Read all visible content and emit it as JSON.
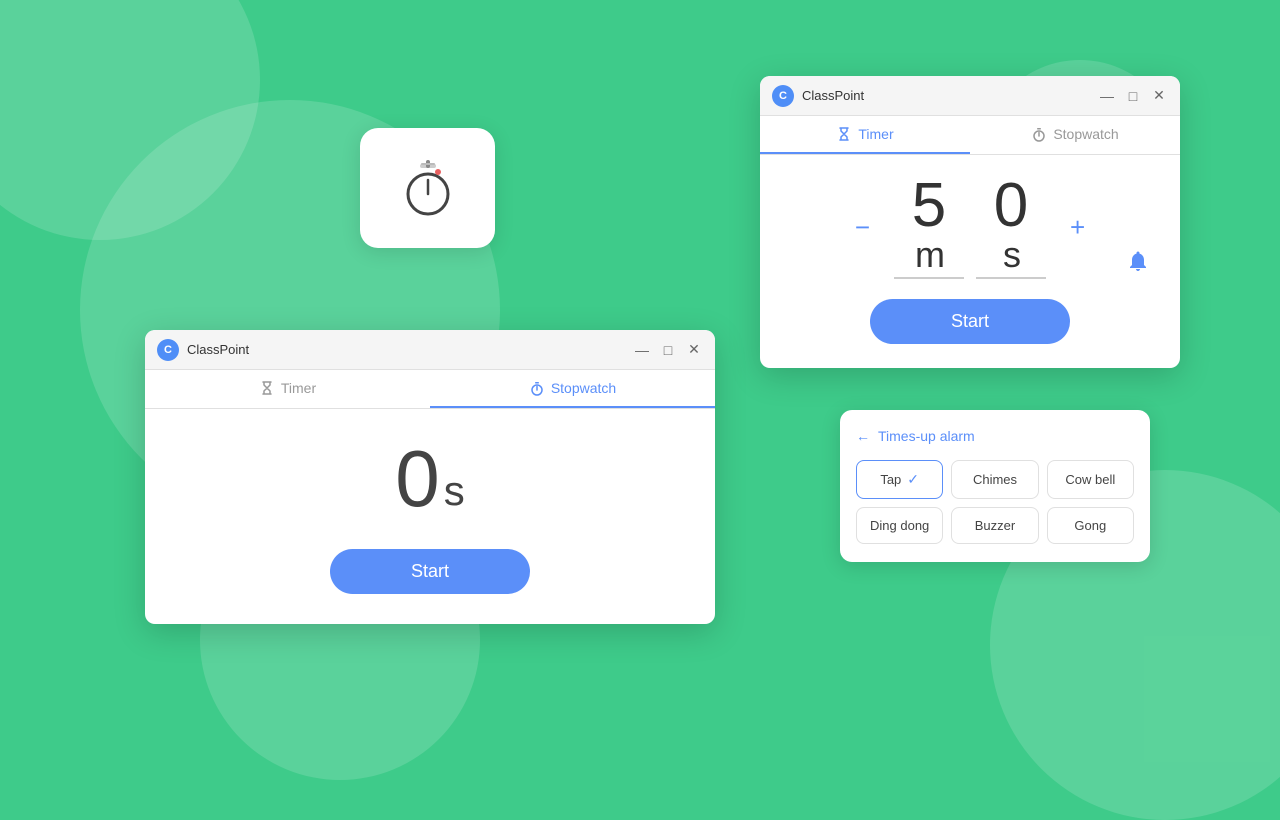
{
  "background": {
    "color": "#3ecb8a"
  },
  "timer_icon_card": {
    "visible": true
  },
  "window_timer": {
    "title": "ClassPoint",
    "tabs": [
      {
        "id": "timer",
        "label": "Timer",
        "active": true
      },
      {
        "id": "stopwatch",
        "label": "Stopwatch",
        "active": false
      }
    ],
    "controls": [
      "minimize",
      "maximize",
      "close"
    ],
    "timer": {
      "minutes": "5",
      "seconds": "0",
      "start_label": "Start"
    }
  },
  "window_stopwatch": {
    "title": "ClassPoint",
    "tabs": [
      {
        "id": "timer",
        "label": "Timer",
        "active": false
      },
      {
        "id": "stopwatch",
        "label": "Stopwatch",
        "active": true
      }
    ],
    "controls": [
      "minimize",
      "maximize",
      "close"
    ],
    "stopwatch": {
      "seconds": "0",
      "start_label": "Start"
    }
  },
  "alarm_panel": {
    "back_label": "Times-up alarm",
    "options": [
      {
        "id": "tap",
        "label": "Tap",
        "selected": true
      },
      {
        "id": "chimes",
        "label": "Chimes",
        "selected": false
      },
      {
        "id": "cowbell",
        "label": "Cow bell",
        "selected": false
      },
      {
        "id": "dingdong",
        "label": "Ding dong",
        "selected": false
      },
      {
        "id": "buzzer",
        "label": "Buzzer",
        "selected": false
      },
      {
        "id": "gong",
        "label": "Gong",
        "selected": false
      }
    ]
  }
}
